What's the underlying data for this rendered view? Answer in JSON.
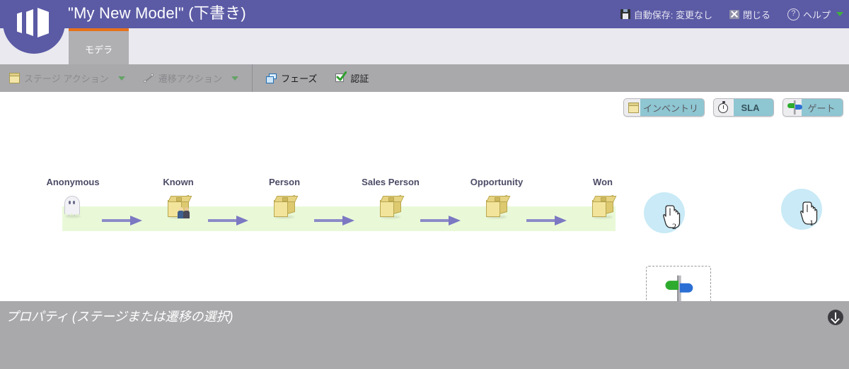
{
  "header": {
    "title": "\"My New Model\" (下書き)",
    "autosave_label": "自動保存: 変更なし",
    "close_label": "閉じる",
    "help_label": "ヘルプ"
  },
  "tabs": [
    {
      "label": "モデラ",
      "active": true
    }
  ],
  "toolbar": {
    "stage_action_label": "ステージ アクション",
    "transition_action_label": "遷移アクション",
    "phase_label": "フェーズ",
    "approval_label": "認証"
  },
  "palette": {
    "inventory_label": "インベントリ",
    "sla_label": "SLA",
    "gate_label": "ゲート"
  },
  "diagram": {
    "stages": [
      {
        "name": "Anonymous",
        "glyph": "ghost-icon"
      },
      {
        "name": "Known",
        "glyph": "package-people-icon"
      },
      {
        "name": "Person",
        "glyph": "package-icon"
      },
      {
        "name": "Sales Person",
        "glyph": "package-icon"
      },
      {
        "name": "Opportunity",
        "glyph": "package-icon"
      },
      {
        "name": "Won",
        "glyph": "package-icon"
      }
    ],
    "transitions_count": 5,
    "drop_target_glyph": "signpost-gate-icon"
  },
  "cursors": [
    {
      "id": "1",
      "label": "1"
    },
    {
      "id": "2",
      "label": "2"
    }
  ],
  "properties": {
    "title": "プロパティ (ステージまたは遷移の選択)"
  },
  "colors": {
    "header_purple": "#5b5aa5",
    "tab_accent_orange": "#e8711a",
    "toolbar_gray": "#a9a9ac",
    "band_green": "#e9f9d8",
    "arrow_purple": "#8d8ac8",
    "selection_teal": "#8ec6d2",
    "cursor_halo_blue": "#bfe6f5"
  }
}
